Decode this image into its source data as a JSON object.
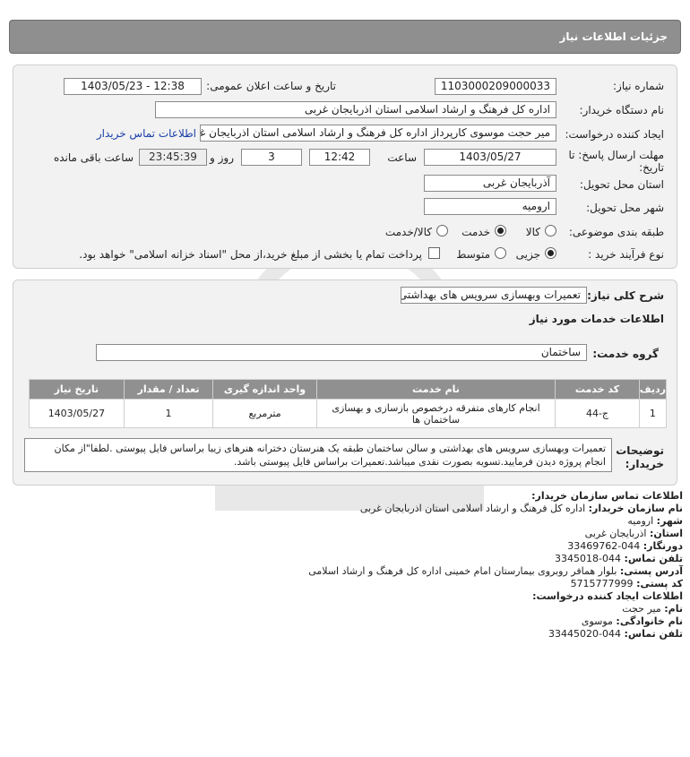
{
  "header": {
    "title": "جزئیات اطلاعات نیاز"
  },
  "fields": {
    "need_number_label": "شماره نیاز:",
    "need_number": "1103000209000033",
    "announce_label": "تاریخ و ساعت اعلان عمومی:",
    "announce_value": "1403/05/23 - 12:38",
    "buyer_org_label": "نام دستگاه خریدار:",
    "buyer_org": "اداره کل فرهنگ و ارشاد اسلامی استان اذربایجان غربی",
    "creator_label": "ایجاد کننده درخواست:",
    "creator": "میر حجت موسوی کارپرداز اداره کل فرهنگ و ارشاد اسلامی استان اذربایجان غربی",
    "contact_link": "اطلاعات تماس خریدار",
    "deadline_label_line1": "مهلت ارسال پاسخ: تا",
    "deadline_label_line2": "تاریخ:",
    "deadline_date": "1403/05/27",
    "time_label": "ساعت",
    "deadline_time": "12:42",
    "days_value": "3",
    "days_label": "روز و",
    "remaining_time": "23:45:39",
    "remaining_label": "ساعت باقی مانده",
    "province_label": "استان محل تحویل:",
    "province": "آذربایجان غربی",
    "city_label": "شهر محل تحویل:",
    "city": "ارومیه",
    "category_label": "طبقه بندی موضوعی:",
    "category_options": [
      "کالا",
      "خدمت",
      "کالا/خدمت"
    ],
    "category_selected": "خدمت",
    "process_label": "نوع فرآیند خرید :",
    "process_options": [
      "جزیی",
      "متوسط"
    ],
    "process_selected": "جزیی",
    "payment_note": "پرداخت تمام یا بخشی از مبلغ خرید،از محل \"اسناد خزانه اسلامی\" خواهد بود."
  },
  "summary": {
    "general_desc_label": "شرح کلی نیاز:",
    "general_desc": "تعمیرات وبهسازی سرویس های بهداشتی",
    "services_heading": "اطلاعات خدمات مورد نیاز",
    "service_group_label": "گروه خدمت:",
    "service_group": "ساختمان"
  },
  "table": {
    "headers": [
      "ردیف",
      "کد خدمت",
      "نام خدمت",
      "واحد اندازه گیری",
      "تعداد / مقدار",
      "تاریخ نیاز"
    ],
    "row": {
      "index": "1",
      "code": "ج-44",
      "name": "انجام کارهای متفرقه درخصوص بازسازی و بهسازی ساختمان ها",
      "unit": "مترمربع",
      "qty": "1",
      "date": "1403/05/27"
    }
  },
  "buyer_notes": {
    "label": "توضیحات خریدار:",
    "text": "تعمیرات وبهسازی سرویس های بهداشتی و سالن ساختمان طبقه یک هنرستان دخترانه هنرهای زیبا براساس فایل پیوستی .لطفا\"از مکان انجام پروژه دیدن فرمایید.تسویه بصورت نقدی میباشد.تعمیرات براساس فایل پیوستی باشد."
  },
  "contact": {
    "heading": "اطلاعات تماس سازمان خریدار:",
    "org_label": "نام سازمان خریدار:",
    "org": "اداره کل فرهنگ و ارشاد اسلامی استان اذربایجان غربی",
    "city_label": "شهر:",
    "city": "ارومیه",
    "province_label": "استان:",
    "province": "اذربایجان غربی",
    "fax_label": "دورنگار:",
    "fax": "044-33469762",
    "phone_label": "تلفن تماس:",
    "phone": "044-3345018",
    "address_label": "آدرس پستی:",
    "address": "بلوار همافر روبروی بیمارستان امام خمینی اداره کل فرهنگ و ارشاد اسلامی",
    "postal_label": "کد پستی:",
    "postal": "5715777999",
    "creator_heading": "اطلاعات ایجاد کننده درخواست:",
    "first_name_label": "نام:",
    "first_name": "میر حجت",
    "last_name_label": "نام خانوادگی:",
    "last_name": "موسوی",
    "creator_phone_label": "تلفن تماس:",
    "creator_phone": "044-33445020"
  }
}
